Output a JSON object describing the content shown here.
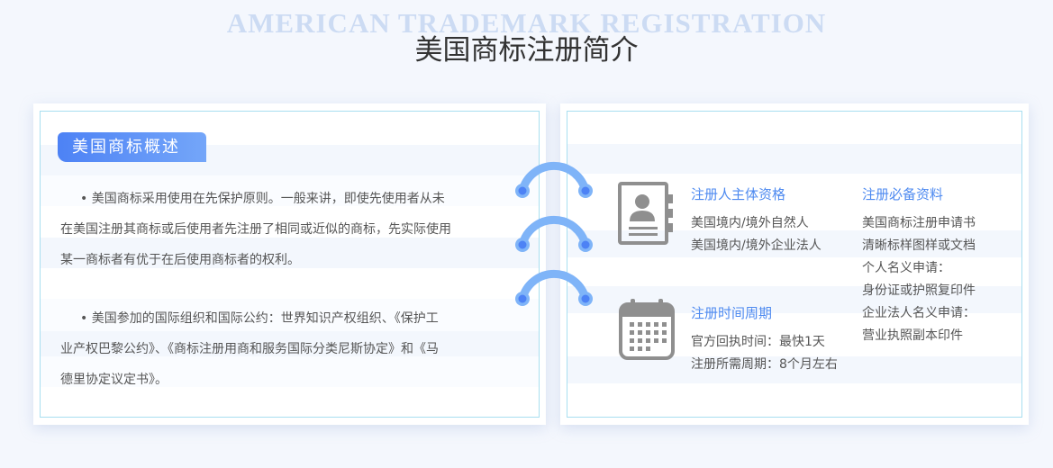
{
  "header": {
    "bg_title": "AMERICAN TRADEMARK REGISTRATION",
    "title": "美国商标注册简介"
  },
  "overview": {
    "badge": "美国商标概述",
    "para1": {
      "bullet": "•",
      "line1": "美国商标采用使用在先保护原则。一般来讲，即使先使用者从未",
      "line2": "在美国注册其商标或后使用者先注册了相同或近似的商标，先实际使用",
      "line3": "某一商标者有优于在后使用商标者的权利。"
    },
    "para2": {
      "bullet": "•",
      "line1": "美国参加的国际组织和国际公约：世界知识产权组织、《保护工",
      "line2": "业产权巴黎公约》、《商标注册用商和服务国际分类尼斯协定》和《马",
      "line3": "德里协定议定书》。"
    }
  },
  "details": {
    "qualification": {
      "icon": "id-card-icon",
      "title": "注册人主体资格",
      "items": [
        "美国境内/境外自然人",
        "美国境内/境外企业法人"
      ]
    },
    "period": {
      "icon": "calendar-icon",
      "title": "注册时间周期",
      "items": [
        "官方回执时间：最快1天",
        "注册所需周期：8个月左右"
      ]
    },
    "materials": {
      "title": "注册必备资料",
      "items": [
        "美国商标注册申请书",
        "清晰标样图样或文档",
        "个人名义申请：",
        "身份证或护照复印件",
        "企业法人名义申请：",
        "营业执照副本印件"
      ]
    }
  },
  "colors": {
    "accent": "#4e8af0",
    "badge_start": "#4d82f5",
    "badge_end": "#74a6f9",
    "icon_gray": "#8f8f8f",
    "connector_blue": "#7fb4f8",
    "frame": "#a9dff0"
  }
}
